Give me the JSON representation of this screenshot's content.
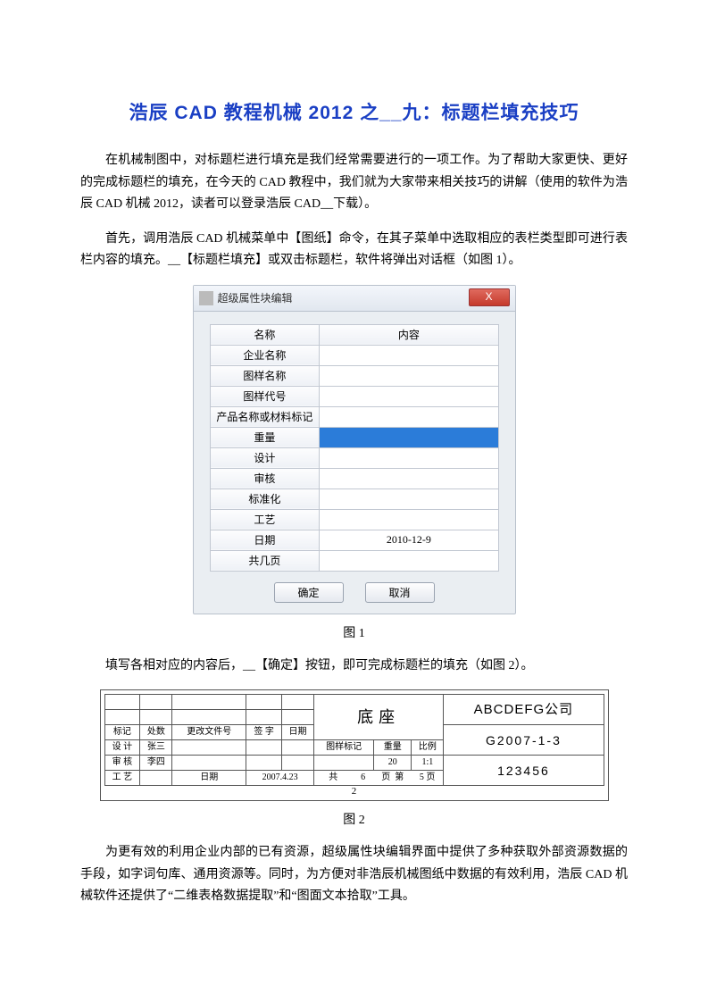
{
  "article": {
    "title": "浩辰 CAD 教程机械 2012 之__九：标题栏填充技巧",
    "para1": "在机械制图中，对标题栏进行填充是我们经常需要进行的一项工作。为了帮助大家更快、更好的完成标题栏的填充，在今天的 CAD 教程中，我们就为大家带来相关技巧的讲解（使用的软件为浩辰 CAD 机械 2012，读者可以登录浩辰 CAD__下载）。",
    "para2": "首先，调用浩辰 CAD 机械菜单中【图纸】命令，在其子菜单中选取相应的表栏类型即可进行表栏内容的填充。__【标题栏填充】或双击标题栏，软件将弹出对话框（如图 1）。",
    "fig1_caption": "图 1",
    "para3": "填写各相对应的内容后，__【确定】按钮，即可完成标题栏的填充（如图 2）。",
    "fig2_caption": "图 2",
    "para4": "为更有效的利用企业内部的已有资源，超级属性块编辑界面中提供了多种获取外部资源数据的手段，如字词句库、通用资源等。同时，为方便对非浩辰机械图纸中数据的有效利用，浩辰 CAD 机械软件还提供了“二维表格数据提取”和“图面文本拾取”工具。"
  },
  "dialog": {
    "title": "超级属性块编辑",
    "close": "X",
    "header_name": "名称",
    "header_value": "内容",
    "rows": [
      {
        "label": "企业名称",
        "value": ""
      },
      {
        "label": "图样名称",
        "value": ""
      },
      {
        "label": "图样代号",
        "value": ""
      },
      {
        "label": "产品名称或材料标记",
        "value": ""
      },
      {
        "label": "重量",
        "value": "",
        "selected": true
      },
      {
        "label": "设计",
        "value": ""
      },
      {
        "label": "审核",
        "value": ""
      },
      {
        "label": "标准化",
        "value": ""
      },
      {
        "label": "工艺",
        "value": ""
      },
      {
        "label": "日期",
        "value": "2010-12-9"
      },
      {
        "label": "共几页",
        "value": ""
      }
    ],
    "ok": "确定",
    "cancel": "取消"
  },
  "titleblock": {
    "company": "ABCDEFG公司",
    "drawing_no": "G2007-1-3",
    "number": "123456",
    "part_name": "底座",
    "labels": {
      "biaoji": "标记",
      "chushu": "处数",
      "gwh": "更改文件号",
      "qianzi": "签 字",
      "riqi": "日期",
      "sheji": "设 计",
      "zhangsan": "张三",
      "shenhe": "审 核",
      "lisi": "李四",
      "gongyi": "工 艺",
      "riqi2": "日期",
      "date": "2007.4.23",
      "gybz": "图样标记",
      "zhongliang": "重量",
      "bili": "比例",
      "wt": "20",
      "scale": "1:1",
      "gong": "共",
      "ye": "页",
      "di": "第",
      "six": "6",
      "five": "5",
      "pagenum": "2"
    }
  }
}
